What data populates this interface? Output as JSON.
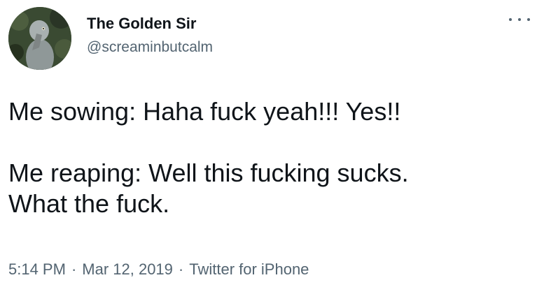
{
  "author": {
    "display_name": "The Golden Sir",
    "handle": "@screaminbutcalm",
    "avatar_icon": "shoebill-bird-avatar"
  },
  "menu": {
    "icon": "more-icon"
  },
  "tweet": {
    "lines": [
      "Me sowing: Haha fuck yeah!!! Yes!!",
      "Me reaping: Well this fucking sucks.",
      "What the fuck."
    ]
  },
  "meta": {
    "time": "5:14 PM",
    "separator": "·",
    "date": "Mar 12, 2019",
    "source": "Twitter for iPhone"
  },
  "colors": {
    "text": "#0f1419",
    "secondary": "#536471",
    "background": "#ffffff"
  }
}
